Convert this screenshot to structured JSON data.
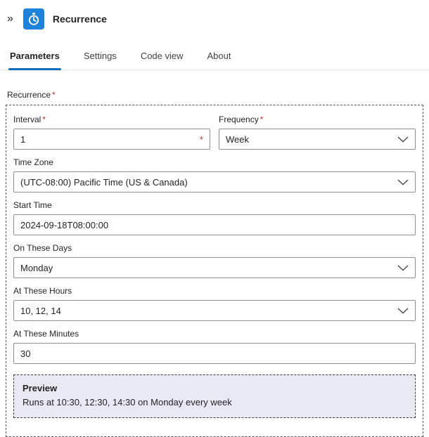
{
  "header": {
    "collapse_glyph": "»",
    "title": "Recurrence",
    "icon": "recurrence-timer-icon"
  },
  "tabs": [
    {
      "label": "Parameters",
      "active": true
    },
    {
      "label": "Settings",
      "active": false
    },
    {
      "label": "Code view",
      "active": false
    },
    {
      "label": "About",
      "active": false
    }
  ],
  "required_marker": "*",
  "section": {
    "label": "Recurrence"
  },
  "fields": {
    "interval": {
      "label": "Interval",
      "required": true,
      "value": "1",
      "type": "text"
    },
    "frequency": {
      "label": "Frequency",
      "required": true,
      "value": "Week",
      "type": "dropdown"
    },
    "timezone": {
      "label": "Time Zone",
      "required": false,
      "value": "(UTC-08:00) Pacific Time (US & Canada)",
      "type": "dropdown"
    },
    "start_time": {
      "label": "Start Time",
      "required": false,
      "value": "2024-09-18T08:00:00",
      "type": "text"
    },
    "on_these_days": {
      "label": "On These Days",
      "required": false,
      "value": "Monday",
      "type": "dropdown"
    },
    "at_these_hours": {
      "label": "At These Hours",
      "required": false,
      "value": "10, 12, 14",
      "type": "dropdown"
    },
    "at_these_minutes": {
      "label": "At These Minutes",
      "required": false,
      "value": "30",
      "type": "text"
    }
  },
  "preview": {
    "title": "Preview",
    "text": "Runs at 10:30, 12:30, 14:30 on Monday every week"
  },
  "colors": {
    "icon_bg": "#1f82da",
    "accent": "#0f6cbd",
    "required_red": "#bc2f32",
    "preview_bg": "#e9e8f5"
  }
}
